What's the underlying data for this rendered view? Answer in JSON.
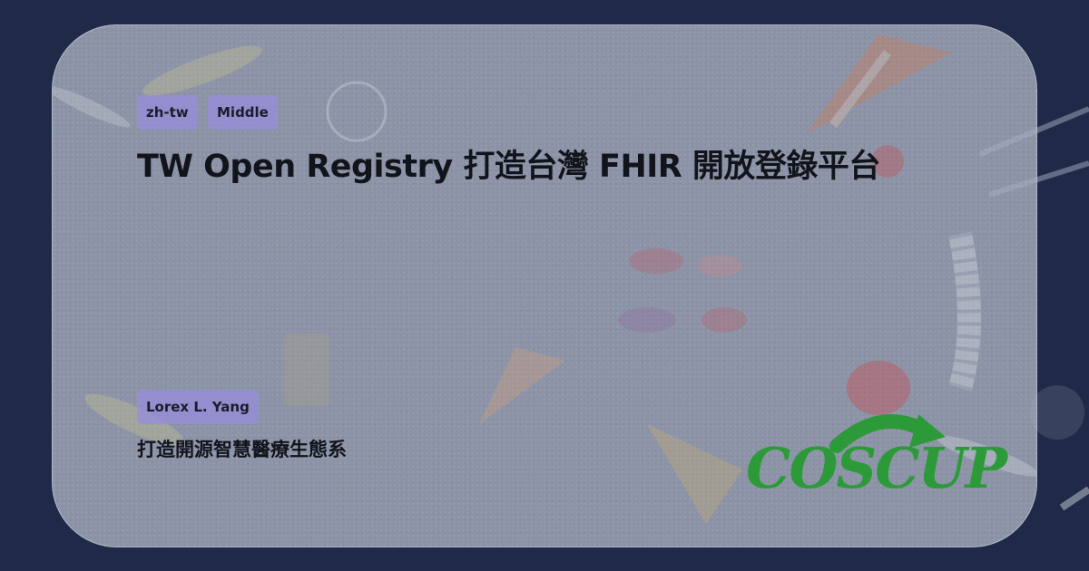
{
  "tags": {
    "language": "zh-tw",
    "level": "Middle"
  },
  "talk": {
    "title": "TW Open Registry 打造台灣 FHIR 開放登錄平台",
    "speaker": "Lorex L. Yang",
    "subtitle": "打造開源智慧醫療生態系"
  },
  "logo": {
    "text": "COSCUP",
    "icon": "green-arrow-icon"
  },
  "colors": {
    "background": "#1f2a48",
    "card": "#a8aebe",
    "tag": "#968edc",
    "logo_green": "#2d9a3a",
    "text": "#12141c"
  }
}
